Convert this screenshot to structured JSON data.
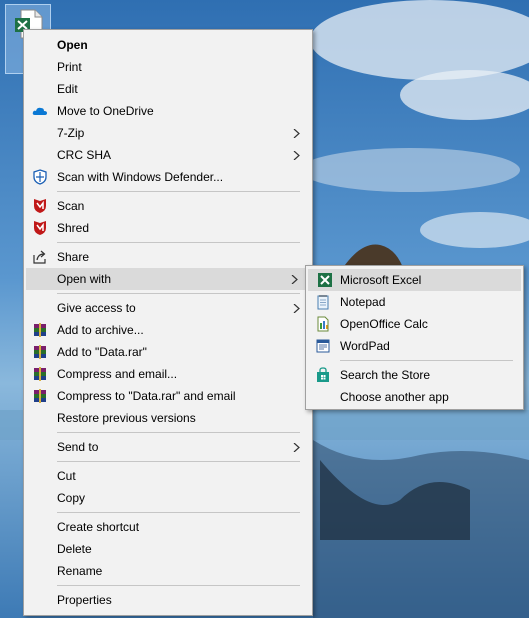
{
  "desktop": {
    "file_icon": "excel-file-icon"
  },
  "context_menu": {
    "items": [
      {
        "label": "Open",
        "bold": true
      },
      {
        "label": "Print"
      },
      {
        "label": "Edit"
      },
      {
        "label": "Move to OneDrive",
        "icon": "onedrive-cloud-icon"
      },
      {
        "label": "7-Zip",
        "submenu": true
      },
      {
        "label": "CRC SHA",
        "submenu": true
      },
      {
        "label": "Scan with Windows Defender...",
        "icon": "windows-defender-shield-icon"
      },
      {
        "label": "Scan",
        "icon": "mcafee-shield-icon"
      },
      {
        "label": "Shred",
        "icon": "mcafee-shield-icon"
      },
      {
        "label": "Share",
        "icon": "share-icon"
      },
      {
        "label": "Open with",
        "submenu": true,
        "highlighted": true
      },
      {
        "label": "Give access to",
        "submenu": true
      },
      {
        "label": "Add to archive...",
        "icon": "winrar-books-icon"
      },
      {
        "label": "Add to \"Data.rar\"",
        "icon": "winrar-books-icon"
      },
      {
        "label": "Compress and email...",
        "icon": "winrar-books-icon"
      },
      {
        "label": "Compress to \"Data.rar\" and email",
        "icon": "winrar-books-icon"
      },
      {
        "label": "Restore previous versions"
      },
      {
        "label": "Send to",
        "submenu": true
      },
      {
        "label": "Cut"
      },
      {
        "label": "Copy"
      },
      {
        "label": "Create shortcut"
      },
      {
        "label": "Delete"
      },
      {
        "label": "Rename"
      },
      {
        "label": "Properties"
      }
    ]
  },
  "open_with_submenu": {
    "items": [
      {
        "label": "Microsoft Excel",
        "icon": "excel-icon",
        "highlighted": true
      },
      {
        "label": "Notepad",
        "icon": "notepad-icon"
      },
      {
        "label": "OpenOffice Calc",
        "icon": "openoffice-calc-icon"
      },
      {
        "label": "WordPad",
        "icon": "wordpad-icon"
      },
      {
        "label": "Search the Store",
        "icon": "store-bag-icon"
      },
      {
        "label": "Choose another app"
      }
    ]
  },
  "colors": {
    "menu_background": "#f2f2f2",
    "highlight": "#dadada",
    "separator": "#c6c6c6",
    "excel_green": "#1e7145",
    "mcafee_red": "#c01818",
    "onedrive_blue": "#0a78d4"
  }
}
